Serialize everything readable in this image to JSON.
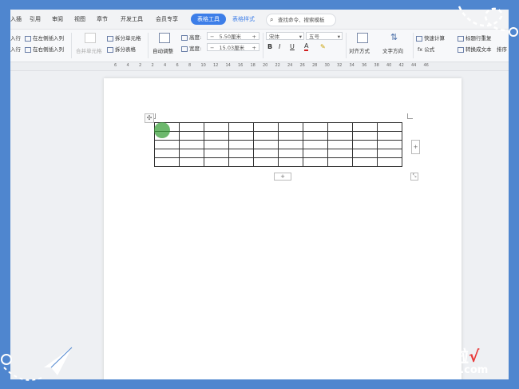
{
  "tabs": {
    "t0": "入插",
    "t1": "引用",
    "t2": "审阅",
    "t3": "视图",
    "t4": "章节",
    "t5": "开发工具",
    "t6": "会员专享",
    "table_tools": "表格工具",
    "table_style": "表格样式",
    "search": "查找命令、搜索模板"
  },
  "ribbon": {
    "insert_row_left": "入行",
    "insert_col_left": "在左侧插入列",
    "insert_row_right": "入行",
    "insert_col_right": "在右侧插入列",
    "merge_cells": "合并单元格",
    "split_cells": "拆分单元格",
    "split_table": "拆分表格",
    "autofit": "自动调整",
    "height_label": "高度:",
    "height_value": "5.50厘米",
    "width_label": "宽度:",
    "width_value": "15.03厘米",
    "font_name": "宋体",
    "font_size": "五号",
    "bold": "B",
    "italic": "I",
    "underline": "U",
    "font_color": "A",
    "align": "对齐方式",
    "text_direction": "文字方向",
    "quick_calc": "快速计算",
    "formula": "fx 公式",
    "header_repeat": "标题行重复",
    "to_text": "转换成文本",
    "sort": "排序"
  },
  "ruler": {
    "marks": [
      "6",
      "4",
      "2",
      "2",
      "4",
      "6",
      "8",
      "10",
      "12",
      "14",
      "16",
      "18",
      "20",
      "22",
      "24",
      "26",
      "28",
      "30",
      "32",
      "34",
      "36",
      "38",
      "40",
      "42",
      "44",
      "46"
    ]
  },
  "table": {
    "rows": 5,
    "cols": 10
  },
  "watermark": {
    "cn": "经验啦",
    "check": "√",
    "pinyin": "jingyanla.com"
  },
  "colors": {
    "accent": "#3d7ee8",
    "frame": "#4f86cf"
  }
}
